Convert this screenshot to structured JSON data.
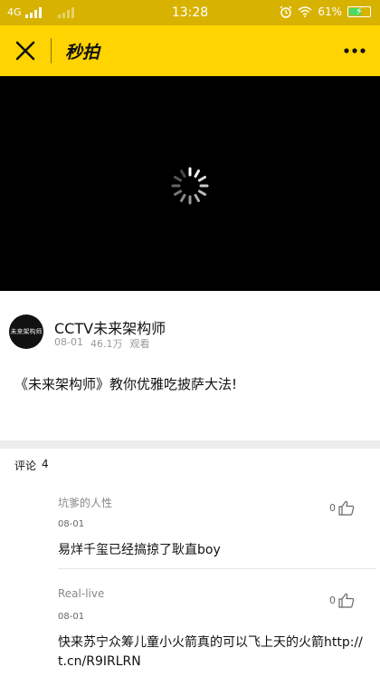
{
  "status_bar": {
    "network": "4G",
    "time": "13:28",
    "battery": "61%",
    "battery_level": 0.61,
    "icons": [
      "signal-icon",
      "alarm-icon",
      "wifi-icon",
      "battery-icon"
    ]
  },
  "app_bar": {
    "title": "秒拍",
    "background_color": "#ffd400",
    "icons": [
      "close-icon",
      "more-icon"
    ]
  },
  "video": {
    "state": "loading",
    "icons": [
      "loading-spinner-icon"
    ]
  },
  "channel": {
    "avatar_text": "未来架构师",
    "name": "CCTV未来架构师",
    "date": "08-01",
    "views": "46.1万",
    "views_label": "观看"
  },
  "video_title": "《未来架构师》教你优雅吃披萨大法!",
  "comments": {
    "label": "评论",
    "count": "4",
    "items": [
      {
        "user": "坑爹的人性",
        "date": "08-01",
        "likes": "0",
        "text": "易烊千玺已经搞掠了耿直boy"
      },
      {
        "user": "Real-live",
        "date": "08-01",
        "likes": "0",
        "text": "快来苏宁众筹儿童小火箭真的可以飞上天的火箭http://t.cn/R9IRLRN"
      }
    ]
  }
}
